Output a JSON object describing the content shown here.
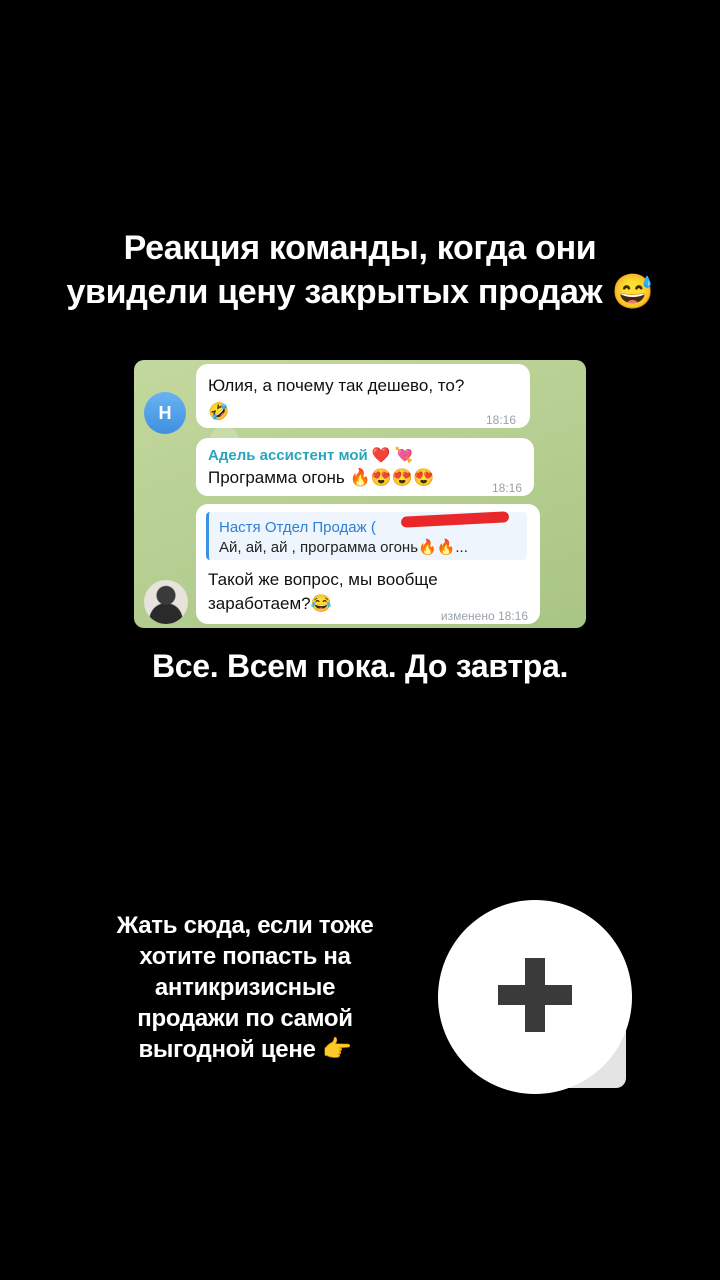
{
  "headline": {
    "line1": "Реакция команды, когда они",
    "line2": "увидели цену закрытых продаж 😅"
  },
  "chat": {
    "message1": {
      "avatar_letter": "Н",
      "text_line1": "Юлия, а почему так дешево, то?",
      "text_line2": "🤣",
      "time": "18:16"
    },
    "message2": {
      "sender": "Адель ассистент мой ❤️ 💘",
      "text": "Программа огонь 🔥😍😍😍",
      "time": "18:16"
    },
    "message3": {
      "reply_sender": "Настя Отдел Продаж (",
      "reply_text": "Ай, ай, ай , программа огонь🔥🔥...",
      "text_line1": "Такой же вопрос, мы вообще",
      "text_line2": "заработаем?😂",
      "time": "изменено 18:16"
    }
  },
  "tagline": "Все. Всем пока. До завтра.",
  "cta": {
    "line1": "Жать сюда, если тоже",
    "line2": "хотите попасть на",
    "line3": "антикризисные",
    "line4": "продажи по самой",
    "line5": "выгодной цене 👉"
  },
  "plus_button": {
    "icon": "plus-icon"
  }
}
